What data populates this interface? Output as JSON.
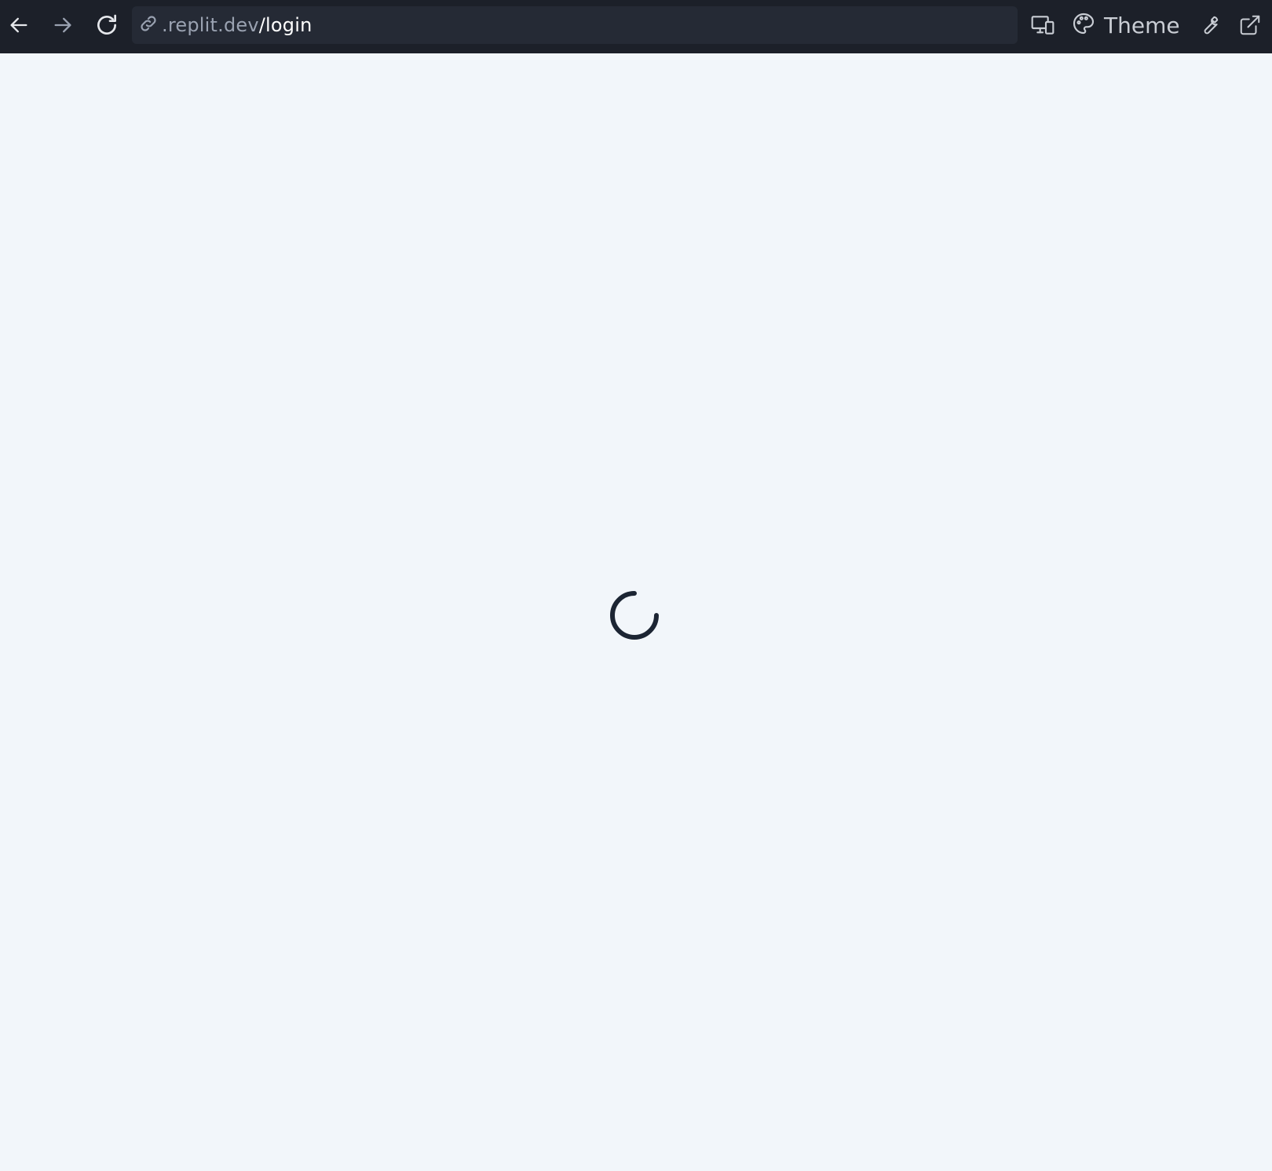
{
  "browser": {
    "url_host": ".replit.dev",
    "url_path": "/login",
    "theme_label": "Theme",
    "icons": {
      "back": "arrow-left-icon",
      "forward": "arrow-right-icon",
      "reload": "reload-icon",
      "link": "link-icon",
      "devices": "devices-icon",
      "palette": "palette-icon",
      "devtools": "wrench-icon",
      "open_external": "external-link-icon"
    }
  },
  "page": {
    "state": "loading",
    "spinner_icon": "loading-spinner-icon",
    "background_color": "#f2f6fa",
    "spinner_color": "#1c2533"
  },
  "colors": {
    "toolbar_bg": "#1c2029",
    "urlbar_bg": "#252a35"
  }
}
